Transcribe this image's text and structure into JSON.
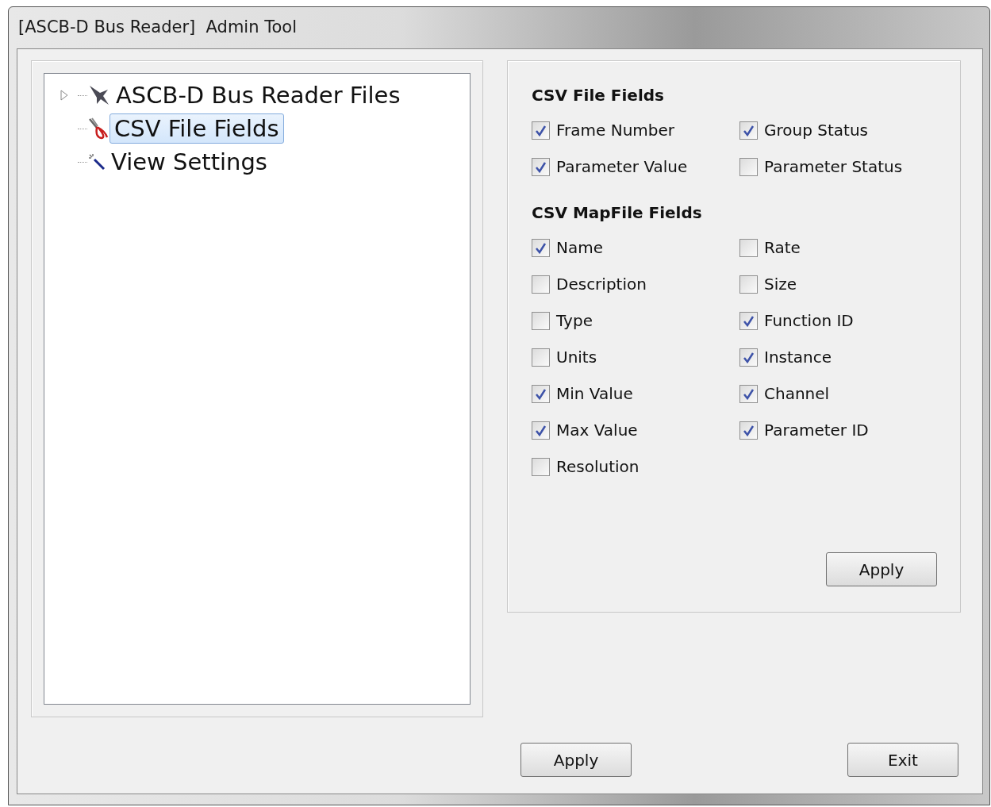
{
  "window": {
    "title": "[ASCB-D Bus Reader]  Admin Tool"
  },
  "tree": [
    {
      "label": "ASCB-D Bus Reader Files",
      "selected": false,
      "expanded": false
    },
    {
      "label": "CSV File Fields",
      "selected": true
    },
    {
      "label": "View Settings",
      "selected": false
    }
  ],
  "sections": [
    {
      "heading": "CSV File Fields",
      "fields": [
        {
          "label": "Frame Number",
          "checked": true
        },
        {
          "label": "Group Status",
          "checked": true
        },
        {
          "label": "Parameter Value",
          "checked": true
        },
        {
          "label": "Parameter Status",
          "checked": false
        }
      ]
    },
    {
      "heading": "CSV MapFile Fields",
      "fields": [
        {
          "label": "Name",
          "checked": true
        },
        {
          "label": "Rate",
          "checked": false
        },
        {
          "label": "Description",
          "checked": false
        },
        {
          "label": "Size",
          "checked": false
        },
        {
          "label": "Type",
          "checked": false
        },
        {
          "label": "Function ID",
          "checked": true
        },
        {
          "label": "Units",
          "checked": false
        },
        {
          "label": "Instance",
          "checked": true
        },
        {
          "label": "Min Value",
          "checked": true
        },
        {
          "label": "Channel",
          "checked": true
        },
        {
          "label": "Max Value",
          "checked": true
        },
        {
          "label": "Parameter ID",
          "checked": true
        },
        {
          "label": "Resolution",
          "checked": false
        }
      ]
    }
  ],
  "panel_button": "Apply",
  "footer_buttons": [
    "Apply",
    "Exit"
  ]
}
